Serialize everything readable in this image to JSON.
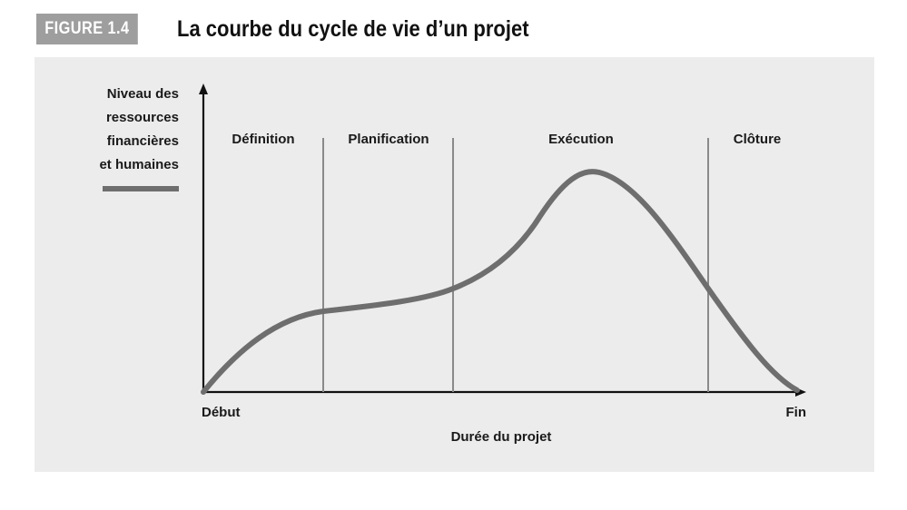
{
  "figure": {
    "label": "FIGURE 1.4",
    "title": "La courbe du cycle de vie d’un projet"
  },
  "y_axis": {
    "label_lines": [
      "Niveau des",
      "ressources",
      "financières",
      "et humaines"
    ]
  },
  "x_axis": {
    "label": "Durée du projet",
    "start_label": "Début",
    "end_label": "Fin"
  },
  "phases": [
    {
      "label": "Définition"
    },
    {
      "label": "Planification"
    },
    {
      "label": "Exécution"
    },
    {
      "label": "Clôture"
    }
  ],
  "colors": {
    "curve": "#6e6e6e",
    "panel": "#ececec",
    "figure_label_bg": "#9e9e9e",
    "divider": "#8a8a8a"
  }
}
